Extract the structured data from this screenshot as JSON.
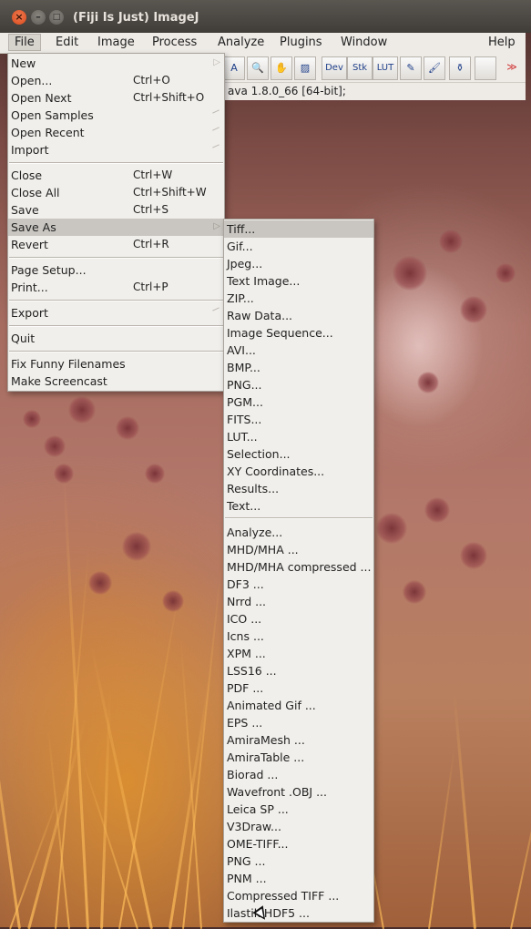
{
  "window": {
    "title": "(Fiji Is Just) ImageJ",
    "close_glyph": "×",
    "min_glyph": "–",
    "max_glyph": "□"
  },
  "menubar": [
    "File",
    "Edit",
    "Image",
    "Process",
    "Analyze",
    "Plugins",
    "Window",
    "Help"
  ],
  "toolbar": {
    "buttons": [
      {
        "icon": "text-tool-icon",
        "glyph": "A"
      },
      {
        "icon": "magnifier-icon",
        "glyph": "🔍"
      },
      {
        "icon": "hand-icon",
        "glyph": "✋"
      },
      {
        "icon": "color-picker-icon",
        "glyph": "▨"
      },
      {
        "icon": "dev-menu-icon",
        "glyph": "Dev"
      },
      {
        "icon": "stk-menu-icon",
        "glyph": "Stk"
      },
      {
        "icon": "lut-menu-icon",
        "glyph": "LUT"
      },
      {
        "icon": "pencil-icon",
        "glyph": "✎"
      },
      {
        "icon": "brush-icon",
        "glyph": "🖌"
      },
      {
        "icon": "flood-fill-icon",
        "glyph": "⚱"
      },
      {
        "icon": "blank-tool-icon",
        "glyph": ""
      },
      {
        "icon": "more-tools-icon",
        "glyph": "≫"
      }
    ]
  },
  "status": "ava 1.8.0_66 [64-bit];",
  "file_menu": {
    "items": [
      {
        "label": "New",
        "accel": "",
        "submenu": true
      },
      {
        "label": "Open...",
        "accel": "Ctrl+O",
        "submenu": false
      },
      {
        "label": "Open Next",
        "accel": "Ctrl+Shift+O",
        "submenu": false
      },
      {
        "label": "Open Samples",
        "accel": "",
        "submenu": true
      },
      {
        "label": "Open Recent",
        "accel": "",
        "submenu": true
      },
      {
        "label": "Import",
        "accel": "",
        "submenu": true
      },
      {
        "label": "Close",
        "accel": "Ctrl+W",
        "submenu": false
      },
      {
        "label": "Close All",
        "accel": "Ctrl+Shift+W",
        "submenu": false
      },
      {
        "label": "Save",
        "accel": "Ctrl+S",
        "submenu": false
      },
      {
        "label": "Save As",
        "accel": "",
        "submenu": true
      },
      {
        "label": "Revert",
        "accel": "Ctrl+R",
        "submenu": false
      },
      {
        "label": "Page Setup...",
        "accel": "",
        "submenu": false
      },
      {
        "label": "Print...",
        "accel": "Ctrl+P",
        "submenu": false
      },
      {
        "label": "Export",
        "accel": "",
        "submenu": true
      },
      {
        "label": "Quit",
        "accel": "",
        "submenu": false
      },
      {
        "label": "Fix Funny Filenames",
        "accel": "",
        "submenu": false
      },
      {
        "label": "Make Screencast",
        "accel": "",
        "submenu": false
      }
    ],
    "highlighted": "Save As"
  },
  "save_as_menu": {
    "items": [
      "Tiff...",
      "Gif...",
      "Jpeg...",
      "Text Image...",
      "ZIP...",
      "Raw Data...",
      "Image Sequence...",
      "AVI...",
      "BMP...",
      "PNG...",
      "PGM...",
      "FITS...",
      "LUT...",
      "Selection...",
      "XY Coordinates...",
      "Results...",
      "Text...",
      "Analyze...",
      "MHD/MHA ...",
      "MHD/MHA compressed ...",
      "DF3 ...",
      "Nrrd ...",
      "ICO ...",
      "Icns ...",
      "XPM ...",
      "LSS16 ...",
      "PDF ...",
      "Animated Gif ...",
      "EPS ...",
      "AmiraMesh ...",
      "AmiraTable ...",
      "Biorad ...",
      "Wavefront .OBJ ...",
      "Leica SP ...",
      "V3Draw...",
      "OME-TIFF...",
      "PNG ...",
      "PNM ...",
      "Compressed TIFF ...",
      "Ilastik HDF5 ..."
    ],
    "highlighted": "Tiff..."
  }
}
